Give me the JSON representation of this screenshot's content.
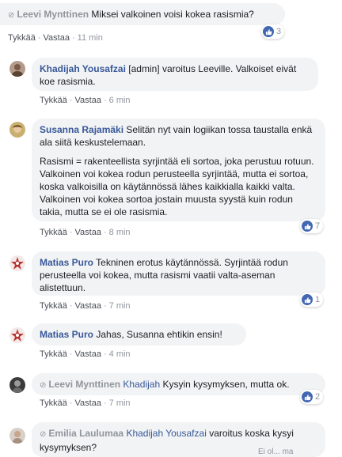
{
  "comments": [
    {
      "name": "Leevi Mynttinen",
      "text": "Miksei valkoinen voisi kokea rasismia?",
      "like": "Tykkää",
      "reply": "Vastaa",
      "time": "11 min",
      "reactions": "3"
    },
    {
      "name": "Khadijah Yousafzai",
      "text": "[admin] varoitus Leeville. Valkoiset eivät koe rasismia.",
      "like": "Tykkää",
      "reply": "Vastaa",
      "time": "6 min"
    },
    {
      "name": "Susanna Rajamäki",
      "text": "Selitän nyt vain logiikan tossa taustalla enkä ala siitä keskustelemaan.",
      "paragraph2": "Rasismi = rakenteellista syrjintää eli sortoa, joka perustuu rotuun. Valkoinen voi kokea rodun perusteella syrjintää, mutta ei sortoa, koska valkoisilla on käytännössä lähes kaikkialla kaikki valta. Valkoinen voi kokea sortoa jostain muusta syystä kuin rodun takia, mutta se ei ole rasismia.",
      "like": "Tykkää",
      "reply": "Vastaa",
      "time": "8 min",
      "reactions": "7"
    },
    {
      "name": "Matias Puro",
      "text": "Tekninen erotus käytännössä. Syrjintää rodun perusteella voi kokea, mutta rasismi vaatii valta-aseman alistettuun.",
      "like": "Tykkää",
      "reply": "Vastaa",
      "time": "7 min",
      "reactions": "1"
    },
    {
      "name": "Matias Puro",
      "text": "Jahas, Susanna ehtikin ensin!",
      "like": "Tykkää",
      "reply": "Vastaa",
      "time": "4 min"
    },
    {
      "name": "Leevi Mynttinen",
      "mention": "Khadijah",
      "text": "Kysyin kysymyksen, mutta ok.",
      "like": "Tykkää",
      "reply": "Vastaa",
      "time": "7 min",
      "reactions": "2"
    },
    {
      "name": "Emilia Laulumaa",
      "mention": "Khadijah Yousafzai",
      "text": "varoitus koska kysyi kysymyksen?"
    }
  ],
  "footer_partial": "Ei ol...  ma",
  "colors": {
    "name": "#385898",
    "bubble": "#f2f3f5",
    "like_badge": "#4267b2",
    "muted": "#90949c"
  },
  "icons": {
    "like": "thumbs-up-icon",
    "status": "check-circle-icon"
  }
}
